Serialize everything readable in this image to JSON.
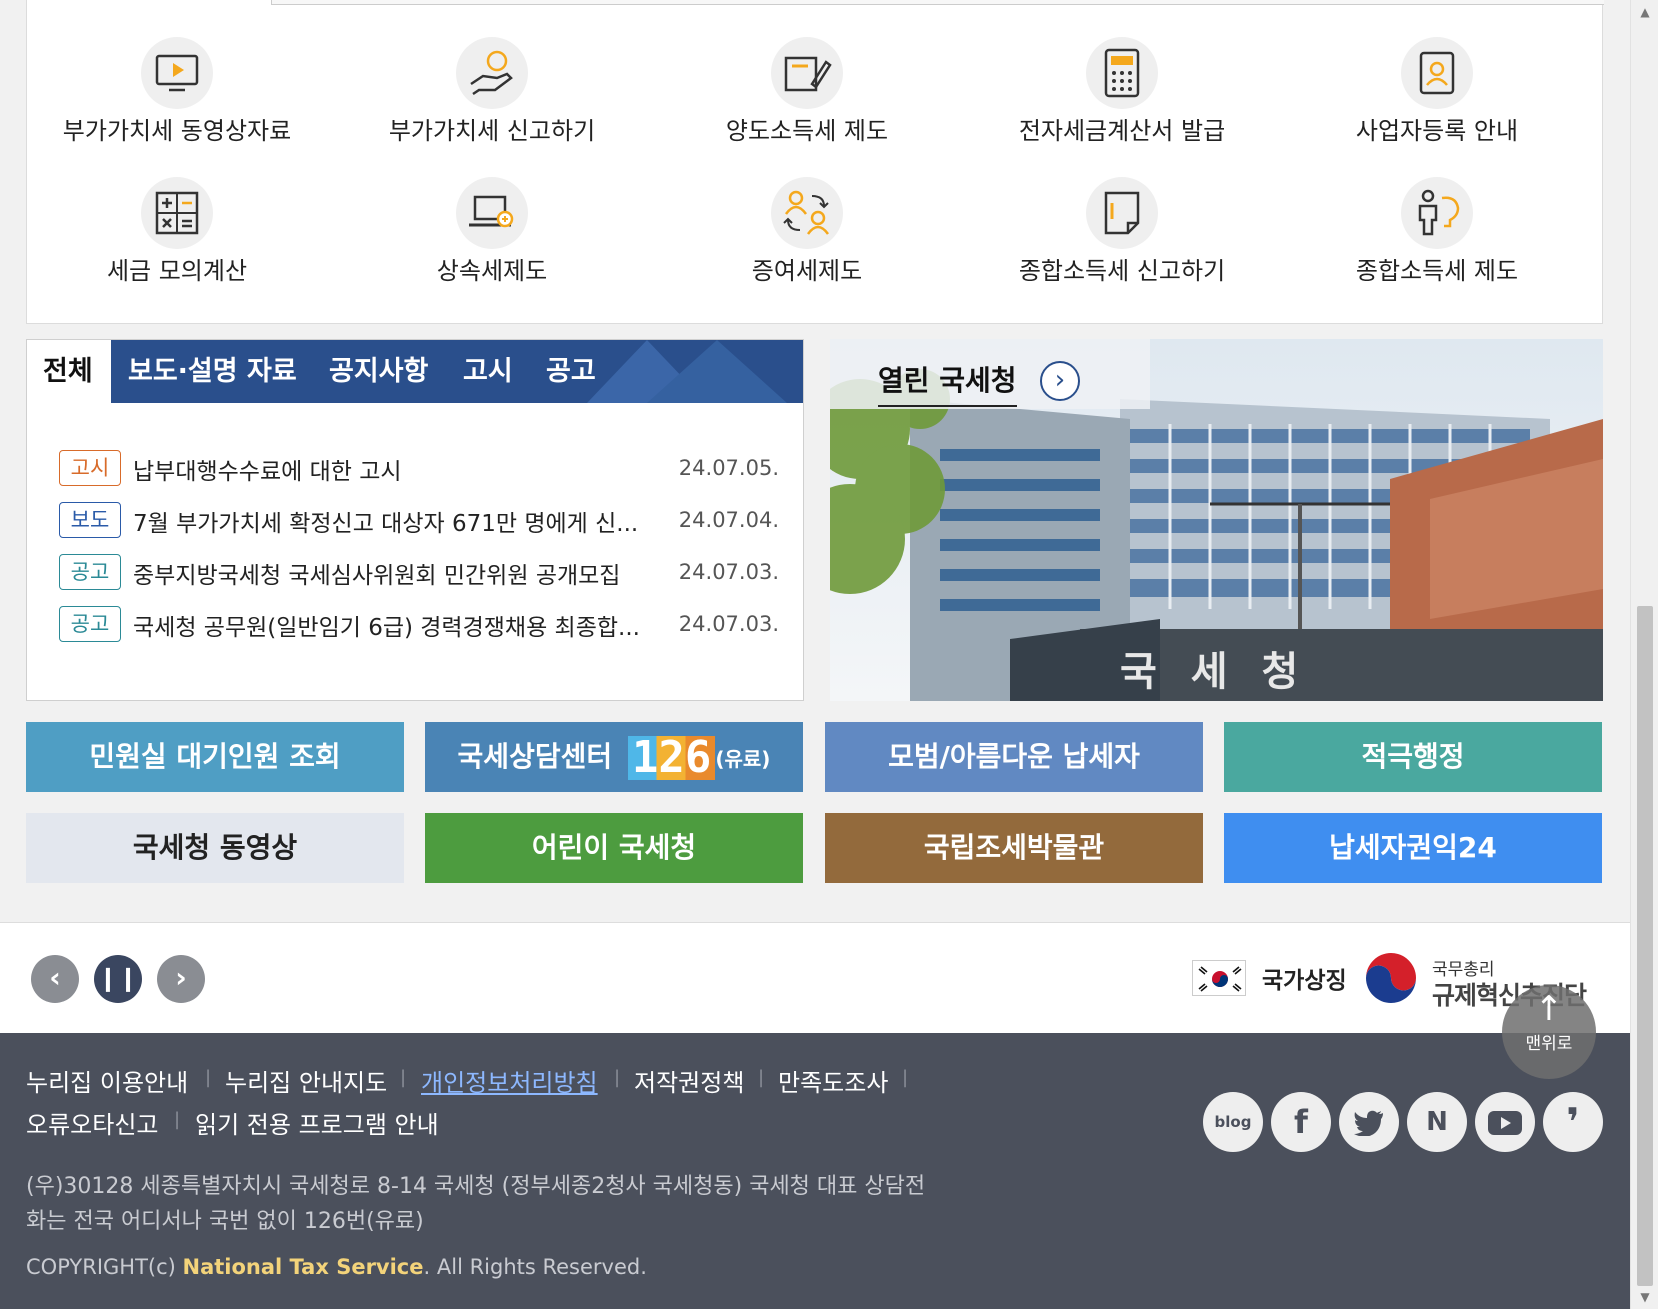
{
  "quick_services": {
    "row1": [
      {
        "label": "부가가치세 동영상자료",
        "icon": "video-play-icon"
      },
      {
        "label": "부가가치세 신고하기",
        "icon": "hand-coin-icon"
      },
      {
        "label": "양도소득세 제도",
        "icon": "document-pen-icon"
      },
      {
        "label": "전자세금계산서 발급",
        "icon": "calculator-icon"
      },
      {
        "label": "사업자등록 안내",
        "icon": "id-card-icon"
      }
    ],
    "row2": [
      {
        "label": "세금 모의계산",
        "icon": "math-symbols-icon"
      },
      {
        "label": "상속세제도",
        "icon": "laptop-icon"
      },
      {
        "label": "증여세제도",
        "icon": "people-transfer-icon"
      },
      {
        "label": "종합소득세 신고하기",
        "icon": "note-icon"
      },
      {
        "label": "종합소득세 제도",
        "icon": "person-bulb-icon"
      }
    ]
  },
  "news": {
    "tabs": [
      "전체",
      "보도·설명 자료",
      "공지사항",
      "고시",
      "공고"
    ],
    "items": [
      {
        "badge": "고시",
        "title": "납부대행수수료에 대한 고시",
        "date": "24.07.05."
      },
      {
        "badge": "보도",
        "title": "7월 부가가치세 확정신고 대상자 671만 명에게 신...",
        "date": "24.07.04."
      },
      {
        "badge": "공고",
        "title": "중부지방국세청 국세심사위원회 민간위원 공개모집",
        "date": "24.07.03."
      },
      {
        "badge": "공고",
        "title": "국세청 공무원(일반임기 6급) 경력경쟁채용 최종합...",
        "date": "24.07.03."
      }
    ]
  },
  "open_nts": {
    "title": "열린 국세청",
    "sign": "국 세 청"
  },
  "links": {
    "row1": [
      {
        "label": "민원실 대기인원 조회",
        "color": "#4f9ec4"
      },
      {
        "label": "국세상담센터",
        "number": "126",
        "suffix": "(유료)",
        "color": "#4a84b5"
      },
      {
        "label": "모범/아름다운 납세자",
        "color": "#6189c2"
      },
      {
        "label": "적극행정",
        "color": "#4aa89f"
      }
    ],
    "row2": [
      {
        "label": "국세청 동영상",
        "color": "#e3e7ee"
      },
      {
        "label": "어린이 국세청",
        "color": "#4d9c3f"
      },
      {
        "label": "국립조세박물관",
        "color": "#936a3c"
      },
      {
        "label": "납세자권익24",
        "color": "#3f8ef0"
      }
    ]
  },
  "strip": {
    "prev_icon": "chevron-left-icon",
    "pause_icon": "pause-icon",
    "next_icon": "chevron-right-icon",
    "national_symbol": "국가상징",
    "reg_small": "국무총리",
    "reg_big": "규제혁신추진단"
  },
  "footer": {
    "links": [
      "누리집 이용안내",
      "누리집 안내지도",
      "개인정보처리방침",
      "저작권정책",
      "만족도조사",
      "오류오타신고",
      "읽기 전용 프로그램 안내"
    ],
    "address_line1": "(우)30128 세종특별자치시 국세청로 8-14 국세청 (정부세종2청사 국세청동) 국세청 대표 상담전",
    "address_line2": "화는 전국 어디서나 국번 없이 126번(유료)",
    "copyright_prefix": "COPYRIGHT(c) ",
    "copyright_org": "National Tax Service",
    "copyright_suffix": ". All Rights Reserved.",
    "social": [
      "blog",
      "f",
      "twitter",
      "N",
      "youtube",
      "kakao"
    ]
  },
  "to_top": {
    "label": "맨위로"
  }
}
